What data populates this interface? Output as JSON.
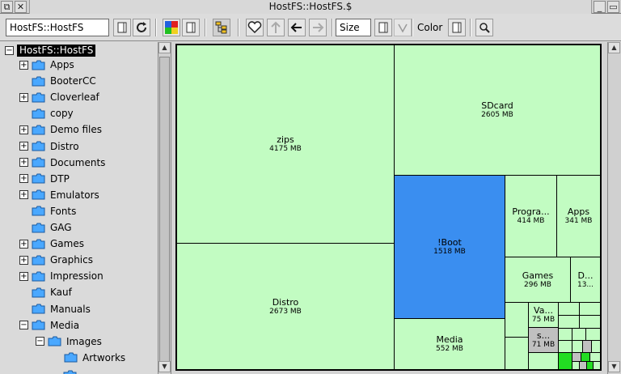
{
  "window": {
    "title": "HostFS::HostFS.$"
  },
  "toolbar": {
    "path_value": "HostFS::HostFS",
    "sort_value": "Size",
    "color_label": "Color"
  },
  "tree": {
    "root": "HostFS::HostFS",
    "items": [
      {
        "label": "Apps",
        "expander": "+"
      },
      {
        "label": "BooterCC",
        "expander": ""
      },
      {
        "label": "Cloverleaf",
        "expander": "+"
      },
      {
        "label": "copy",
        "expander": ""
      },
      {
        "label": "Demo files",
        "expander": "+"
      },
      {
        "label": "Distro",
        "expander": "+"
      },
      {
        "label": "Documents",
        "expander": "+"
      },
      {
        "label": "DTP",
        "expander": "+"
      },
      {
        "label": "Emulators",
        "expander": "+"
      },
      {
        "label": "Fonts",
        "expander": ""
      },
      {
        "label": "GAG",
        "expander": ""
      },
      {
        "label": "Games",
        "expander": "+"
      },
      {
        "label": "Graphics",
        "expander": "+"
      },
      {
        "label": "Impression",
        "expander": "+"
      },
      {
        "label": "Kauf",
        "expander": ""
      },
      {
        "label": "Manuals",
        "expander": ""
      },
      {
        "label": "Media",
        "expander": "−"
      }
    ],
    "sub_items": [
      {
        "label": "Images",
        "expander": "−"
      }
    ],
    "sub_sub_items": [
      {
        "label": "Artworks",
        "expander": ""
      }
    ]
  },
  "treemap": {
    "cells": [
      {
        "name": "zips",
        "size": "4175 MB"
      },
      {
        "name": "Distro",
        "size": "2673 MB"
      },
      {
        "name": "SDcard",
        "size": "2605 MB"
      },
      {
        "name": "!Boot",
        "size": "1518 MB"
      },
      {
        "name": "Media",
        "size": "552 MB"
      },
      {
        "name": "Progra...",
        "size": "414 MB"
      },
      {
        "name": "Apps",
        "size": "341 MB"
      },
      {
        "name": "Games",
        "size": "296 MB"
      },
      {
        "name": "D...",
        "size": "13..."
      },
      {
        "name": "Va...",
        "size": "75 MB"
      },
      {
        "name": "s...",
        "size": "71 MB"
      }
    ]
  },
  "colors": {
    "cell_default": "#c2fcc2",
    "cell_selected": "#3a8ef0",
    "cell_bright": "#22dd22"
  }
}
